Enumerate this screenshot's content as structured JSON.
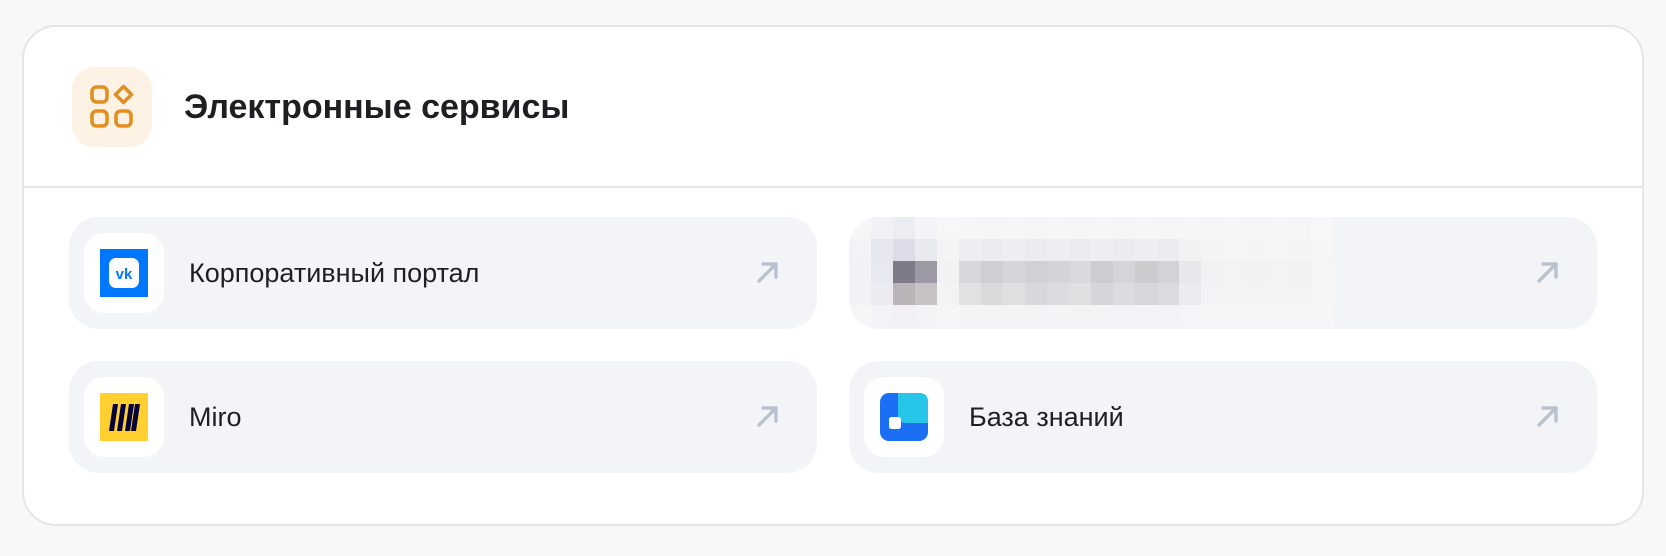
{
  "section": {
    "title": "Электронные сервисы",
    "icon": "apps-grid-icon",
    "accent_color": "#e28f1e",
    "icon_bg": "#fdf2e3"
  },
  "services": [
    {
      "label": "Корпоративный портал",
      "logo": "vk-logo-icon",
      "logo_color": "#0077ff"
    },
    {
      "label": "",
      "logo": "redacted-logo",
      "redacted": true
    },
    {
      "label": "Miro",
      "logo": "miro-logo-icon",
      "logo_color": "#ffd02f"
    },
    {
      "label": "База знаний",
      "logo": "knowledge-base-logo-icon",
      "logo_color": "#1f8bff"
    }
  ],
  "colors": {
    "tile_bg": "#f3f4f7",
    "arrow": "#b9c2cf",
    "text": "#1f1f23",
    "border": "#e3e5ea"
  }
}
